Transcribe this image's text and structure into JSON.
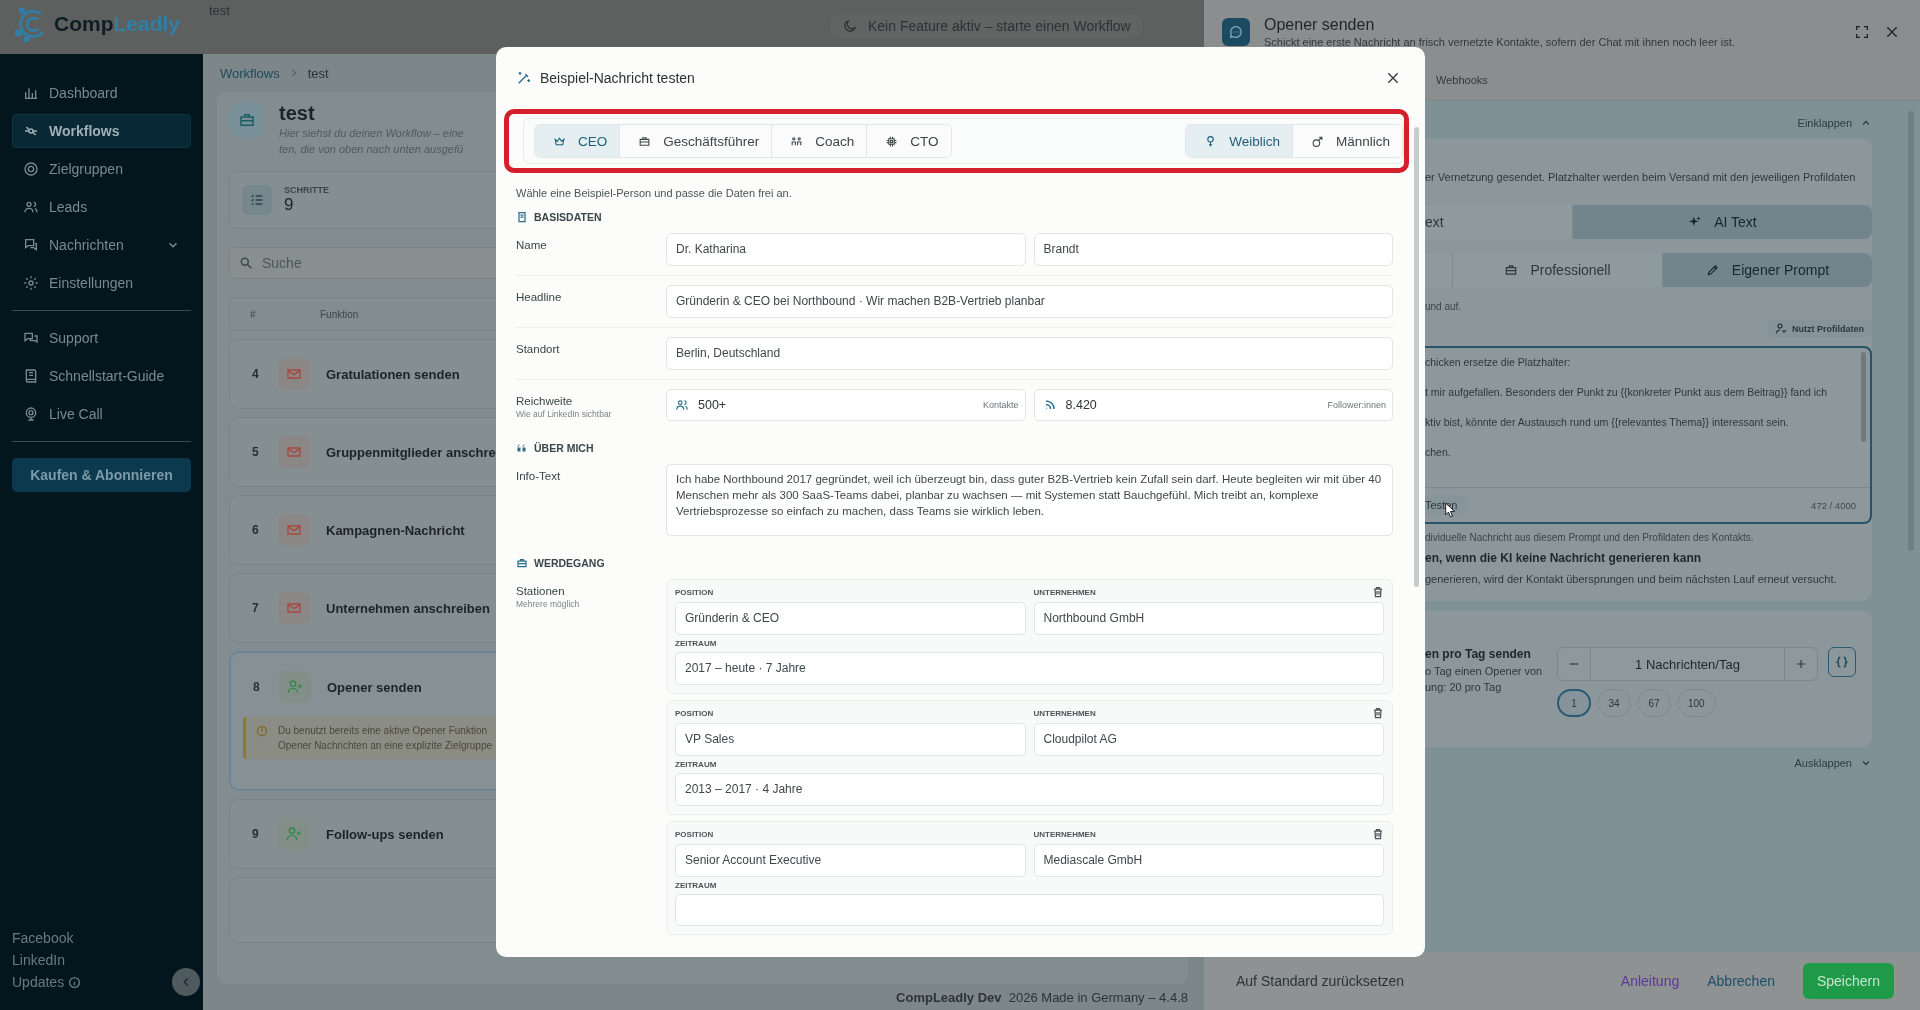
{
  "app_header": {
    "page_title": "test",
    "status_pill": "Kein Feature aktiv – starte einen Workflow"
  },
  "sidebar": {
    "logo": {
      "prefix": "Comp",
      "accent": "Leadly"
    },
    "nav_main": [
      {
        "label": "Dashboard",
        "selected": false
      },
      {
        "label": "Workflows",
        "selected": true
      },
      {
        "label": "Zielgruppen",
        "selected": false
      },
      {
        "label": "Leads",
        "selected": false
      },
      {
        "label": "Nachrichten",
        "selected": false,
        "expanded": false
      },
      {
        "label": "Einstellungen",
        "selected": false
      }
    ],
    "nav_help": [
      {
        "label": "Support",
        "selected": false
      },
      {
        "label": "Schnellstart-Guide",
        "selected": false
      },
      {
        "label": "Live Call",
        "selected": false
      }
    ],
    "cta": "Kaufen & Abonnieren",
    "footer_links": [
      {
        "label": "Facebook",
        "info": false
      },
      {
        "label": "LinkedIn",
        "info": false
      },
      {
        "label": "Updates",
        "info": true
      }
    ]
  },
  "workflow": {
    "breadcrumb": [
      "Workflows",
      "test"
    ],
    "title": "test",
    "description": [
      "Hier siehst du deinen Workflow – eine",
      "ten, die von oben nach unten ausgefü"
    ],
    "steps_label": "SCHRITTE",
    "steps_value": "9",
    "search_placeholder": "Suche",
    "columns": [
      "#",
      "Funktion"
    ],
    "rows": [
      {
        "number": "4",
        "title": "Gratulationen senden",
        "kind": "message",
        "selected": false
      },
      {
        "number": "5",
        "title": "Gruppenmitglieder anschre",
        "kind": "message",
        "selected": false
      },
      {
        "number": "6",
        "title": "Kampagnen-Nachricht",
        "kind": "message",
        "selected": false
      },
      {
        "number": "7",
        "title": "Unternehmen anschreiben",
        "kind": "message",
        "selected": false
      },
      {
        "number": "8",
        "title": "Opener senden",
        "kind": "connect",
        "selected": true,
        "warning": [
          "Du benutzt bereits eine aktive Opener Funktion",
          "Opener Nachrichten an eine explizite Zielgruppe"
        ]
      },
      {
        "number": "9",
        "title": "Follow-ups senden",
        "kind": "connect",
        "selected": false
      }
    ],
    "footer": "**CompLeadly Dev**  2026 Made in Germany – 4.4.8"
  },
  "modal": {
    "title": "Beispiel-Nachricht testen",
    "personas": [
      {
        "label": "CEO",
        "selected": true
      },
      {
        "label": "Geschäftsführer",
        "selected": false
      },
      {
        "label": "Coach",
        "selected": false
      },
      {
        "label": "CTO",
        "selected": false
      }
    ],
    "genders": [
      {
        "label": "Weiblich",
        "selected": true
      },
      {
        "label": "Männlich",
        "selected": false
      }
    ],
    "hint": "Wähle eine Beispiel-Person und passe die Daten frei an.",
    "basics": {
      "heading": "BASISDATEN",
      "name_label": "Name",
      "first_name": "Dr. Katharina",
      "last_name": "Brandt",
      "headline_label": "Headline",
      "headline": "Gründerin & CEO bei Northbound · Wir machen B2B-Vertrieb planbar",
      "location_label": "Standort",
      "location": "Berlin, Deutschland",
      "reach_label": "Reichweite",
      "reach_hint": "Wie auf LinkedIn sichtbar",
      "connections": "500+",
      "connections_unit": "Kontakte",
      "followers": "8.420",
      "followers_unit": "Follower:innen"
    },
    "about": {
      "heading": "ÜBER MICH",
      "label": "Info-Text",
      "text": "Ich habe Northbound 2017 gegründet, weil ich überzeugt bin, dass guter B2B-Vertrieb kein Zufall sein darf. Heute begleiten wir mit über 40 Menschen mehr als 300 SaaS-Teams dabei, planbar zu wachsen — mit Systemen statt Bauchgefühl. Mich treibt an, komplexe Vertriebsprozesse so einfach zu machen, dass Teams sie wirklich leben."
    },
    "career": {
      "heading": "WERDEGANG",
      "label": "Stationen",
      "hint": "Mehrere möglich",
      "stations": [
        {
          "position_label": "POSITION",
          "position": "Gründerin & CEO",
          "company_label": "UNTERNEHMEN",
          "company": "Northbound GmbH",
          "period_label": "ZEITRAUM",
          "period": "2017 – heute · 7 Jahre"
        },
        {
          "position_label": "POSITION",
          "position": "VP Sales",
          "company_label": "UNTERNEHMEN",
          "company": "Cloudpilot AG",
          "period_label": "ZEITRAUM",
          "period": "2013 – 2017 · 4 Jahre"
        },
        {
          "position_label": "POSITION",
          "position": "Senior Account Executive",
          "company_label": "UNTERNEHMEN",
          "company": "Mediascale GmbH",
          "period_label": "ZEITRAUM"
        }
      ]
    }
  },
  "drawer": {
    "title": "Opener senden",
    "subtitle": "Schickt eine erste Nachricht an frisch vernetzte Kontakte, sofern der Chat mit ihnen noch leer ist.",
    "tab": "Webhooks",
    "collapse_label": "Einklappen",
    "intro": "er Vernetzung gesendet. Platzhalter werden beim Versand mit den jeweiligen Profildaten",
    "mode_options": [
      {
        "label": "ext",
        "selected": false
      },
      {
        "label": "AI Text",
        "selected": true
      }
    ],
    "style_options": [
      {
        "label": "Professionell",
        "selected": false
      },
      {
        "label": "Eigener Prompt",
        "selected": true
      }
    ],
    "style_hint": "und auf.",
    "profile_badge": "Nutzt Profildaten",
    "prompt_lines": [
      "chicken ersetze die Platzhalter:",
      "t mir aufgefallen. Besonders der Punkt zu {{konkreter Punkt aus dem Beitrag}} fand ich",
      "ktiv bist, könnte der Austausch rund um {{relevantes Thema}} interessant sein.",
      "chen."
    ],
    "test_button": "Testen",
    "char_count": "472 / 4000",
    "prompt_hint": "dividuelle Nachricht aus diesem Prompt und den Profildaten des Kontakts.",
    "fallback_title": "en, wenn die KI keine Nachricht generieren kann",
    "fallback_text": "generieren, wird der Kontakt übersprungen und beim nächsten Lauf erneut versucht.",
    "limit_title": "en pro Tag senden",
    "limit_lines": [
      "o Tag einen Opener von",
      "ung: 20 pro Tag"
    ],
    "limit_value": "1 Nachrichten/Tag",
    "presets": [
      {
        "label": "1",
        "selected": true
      },
      {
        "label": "34",
        "selected": false
      },
      {
        "label": "67",
        "selected": false
      },
      {
        "label": "100",
        "selected": false
      }
    ],
    "expand_label": "Ausklappen",
    "footer": {
      "reset": "Auf Standard zurücksetzen",
      "guide": "Anleitung",
      "cancel": "Abbrechen",
      "save": "Speichern"
    }
  }
}
